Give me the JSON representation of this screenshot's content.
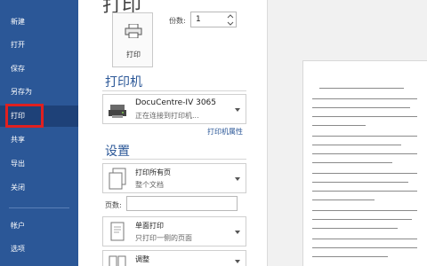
{
  "sidebar": {
    "items": [
      {
        "label": "新建"
      },
      {
        "label": "打开"
      },
      {
        "label": "保存"
      },
      {
        "label": "另存为"
      },
      {
        "label": "打印"
      },
      {
        "label": "共享"
      },
      {
        "label": "导出"
      },
      {
        "label": "关闭"
      },
      {
        "label": "帐户"
      },
      {
        "label": "选项"
      }
    ],
    "active_index": 4
  },
  "print": {
    "button_label": "打印",
    "copies_label": "份数:",
    "copies_value": "1"
  },
  "printer": {
    "section_title": "打印机",
    "name": "DocuCentre-IV 3065",
    "status": "正在连接到打印机...",
    "properties_link": "打印机属性"
  },
  "settings": {
    "section_title": "设置",
    "range_main": "打印所有页",
    "range_sub": "整个文档",
    "pages_label": "页数:",
    "pages_value": "",
    "sides_main": "单面打印",
    "sides_sub": "只打印一侧的页面",
    "collate_main": "调整"
  },
  "colors": {
    "sidebar_bg": "#2b5797",
    "accent": "#2b5797",
    "highlight_box": "#e02020"
  }
}
